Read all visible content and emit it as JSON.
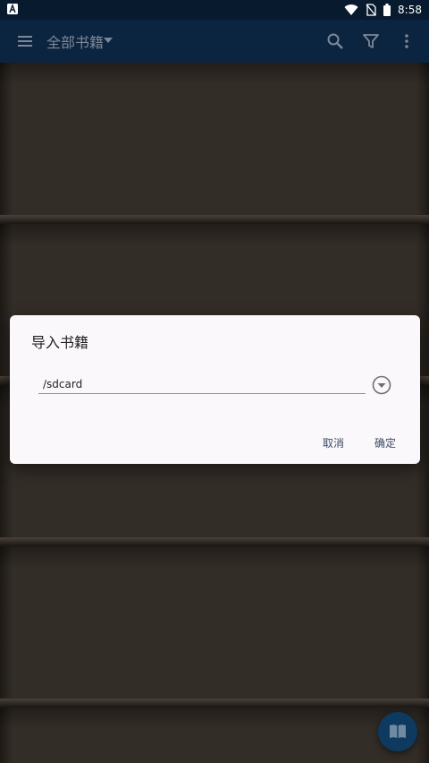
{
  "status_bar": {
    "time": "8:58",
    "icons": [
      "app-notification-icon",
      "wifi-icon",
      "no-sim-icon",
      "battery-icon"
    ]
  },
  "app_bar": {
    "title": "全部书籍",
    "icons": [
      "menu-icon",
      "dropdown-arrow-icon",
      "search-icon",
      "filter-icon",
      "more-vert-icon"
    ]
  },
  "dialog": {
    "title": "导入书籍",
    "path_value": "/sdcard",
    "cancel_label": "取消",
    "ok_label": "确定"
  },
  "fab": {
    "icon": "book-icon"
  },
  "colors": {
    "status_bar": "#071a2e",
    "app_bar": "#0b2440",
    "accent_underline": "#4ea6d3",
    "fab": "#0d3a5e",
    "dialog_bg": "#fbf8fc"
  }
}
